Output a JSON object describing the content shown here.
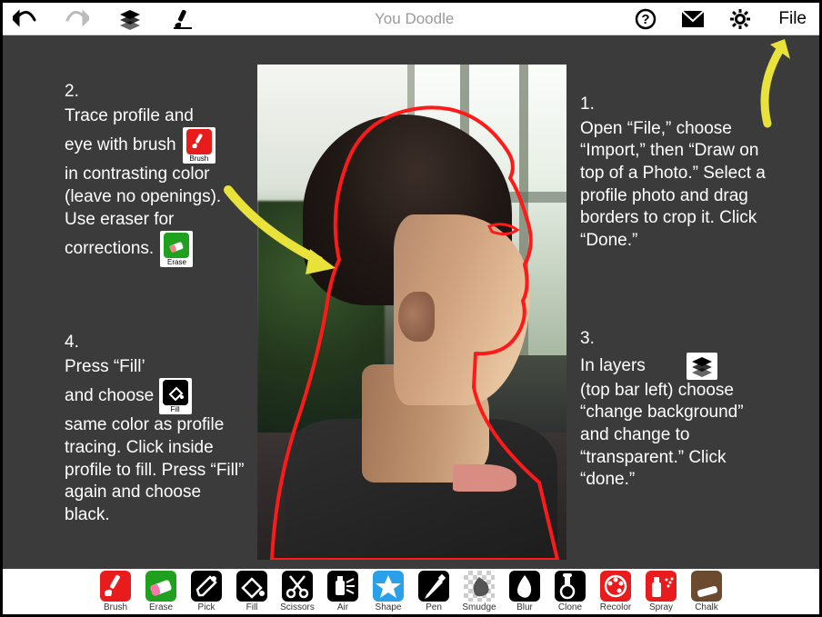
{
  "app": {
    "title": "You Doodle",
    "file_label": "File"
  },
  "instructions": {
    "step1": {
      "num": "1.",
      "text": "Open “File,” choose “Import,” then “Draw on top of a Photo.” Select a profile photo and drag borders to crop it. Click “Done.”"
    },
    "step2": {
      "num": "2.",
      "line_a": "Trace profile and",
      "line_b": "eye with brush",
      "line_c": "in contrasting color (leave no openings). Use eraser for",
      "line_d": "corrections."
    },
    "step3": {
      "num": "3.",
      "line_a": "In layers",
      "line_b": "(top bar left) choose “change background” and change to “transparent.” Click “done.”"
    },
    "step4": {
      "num": "4.",
      "line_a": "Press “Fill’",
      "line_b": "and choose",
      "line_c": "same color as profile tracing. Click inside profile to fill. Press “Fill” again and choose black."
    }
  },
  "mini_icons": {
    "brush": {
      "label": "Brush",
      "bg": "#e81c1c"
    },
    "erase": {
      "label": "Erase",
      "bg": "#1fa01f"
    },
    "fill": {
      "label": "Fill",
      "bg": "#000000"
    }
  },
  "tools": [
    {
      "name": "Brush",
      "bg": "red"
    },
    {
      "name": "Erase",
      "bg": "green"
    },
    {
      "name": "Pick",
      "bg": "black"
    },
    {
      "name": "Fill",
      "bg": "black"
    },
    {
      "name": "Scissors",
      "bg": "black"
    },
    {
      "name": "Air",
      "bg": "black"
    },
    {
      "name": "Shape",
      "bg": "blue"
    },
    {
      "name": "Pen",
      "bg": "black"
    },
    {
      "name": "Smudge",
      "bg": "hatch"
    },
    {
      "name": "Blur",
      "bg": "black"
    },
    {
      "name": "Clone",
      "bg": "black"
    },
    {
      "name": "Recolor",
      "bg": "red"
    },
    {
      "name": "Spray",
      "bg": "red"
    },
    {
      "name": "Chalk",
      "bg": "brown"
    }
  ]
}
